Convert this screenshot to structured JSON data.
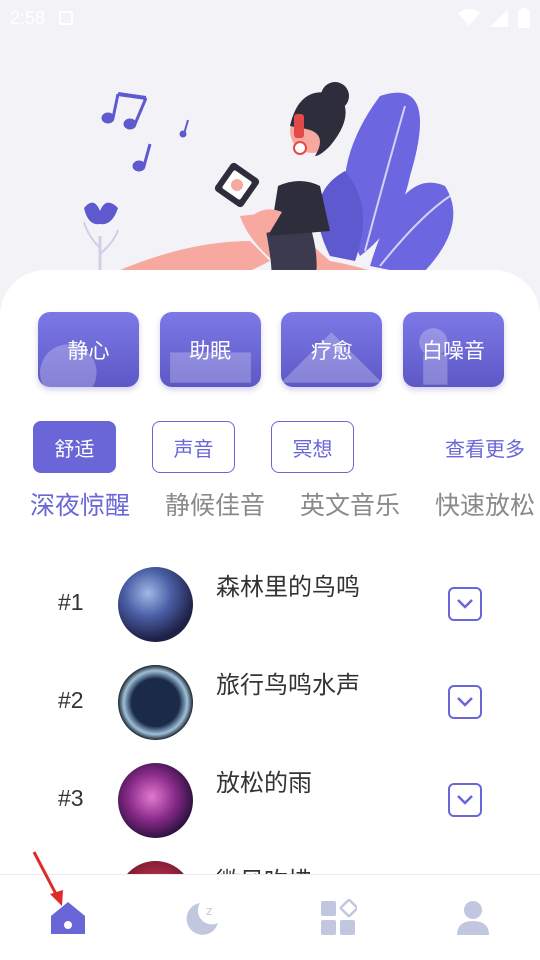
{
  "status_bar": {
    "time": "2:58"
  },
  "categories": [
    {
      "label": "静心"
    },
    {
      "label": "助眠"
    },
    {
      "label": "疗愈"
    },
    {
      "label": "白噪音"
    }
  ],
  "tags": [
    {
      "label": "舒适",
      "active": true
    },
    {
      "label": "声音",
      "active": false
    },
    {
      "label": "冥想",
      "active": false
    }
  ],
  "see_more": "查看更多",
  "sub_tabs": [
    {
      "label": "深夜惊醒",
      "active": true
    },
    {
      "label": "静候佳音",
      "active": false
    },
    {
      "label": "英文音乐",
      "active": false
    },
    {
      "label": "快速放松",
      "active": false
    }
  ],
  "tracks": [
    {
      "rank": "#1",
      "title": "森林里的鸟鸣"
    },
    {
      "rank": "#2",
      "title": "旅行鸟鸣水声"
    },
    {
      "rank": "#3",
      "title": "放松的雨"
    },
    {
      "rank": "",
      "title": "微风吹拂"
    }
  ],
  "bottom_nav": [
    {
      "name": "home",
      "icon": "home-icon",
      "active": true
    },
    {
      "name": "sleep",
      "icon": "moon-sleep-icon",
      "active": false
    },
    {
      "name": "apps",
      "icon": "apps-grid-icon",
      "active": false
    },
    {
      "name": "profile",
      "icon": "person-icon",
      "active": false
    }
  ],
  "colors": {
    "accent": "#6a66d8",
    "card_gradient_top": "#7c79e6",
    "card_gradient_bottom": "#5d58c6"
  }
}
